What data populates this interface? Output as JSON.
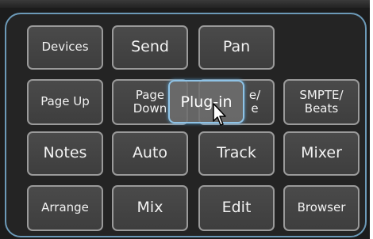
{
  "buttons": {
    "devices": "Devices",
    "send": "Send",
    "pan": "Pan",
    "page_up": "Page Up",
    "page_down_1": "Page",
    "page_down_2": "Down",
    "hidden_1": "e/",
    "hidden_2": "e",
    "smpte_1": "SMPTE/",
    "smpte_2": "Beats",
    "notes": "Notes",
    "auto": "Auto",
    "track": "Track",
    "mixer": "Mixer",
    "arrange": "Arrange",
    "mix": "Mix",
    "edit": "Edit",
    "browser": "Browser"
  },
  "overlay": {
    "label": "Plug-in"
  },
  "colors": {
    "panel_border": "#6c9ab8",
    "button_fill": "#444444",
    "overlay_border": "#8fc3e6"
  },
  "icons": {
    "cursor": "arrow-cursor-icon"
  }
}
